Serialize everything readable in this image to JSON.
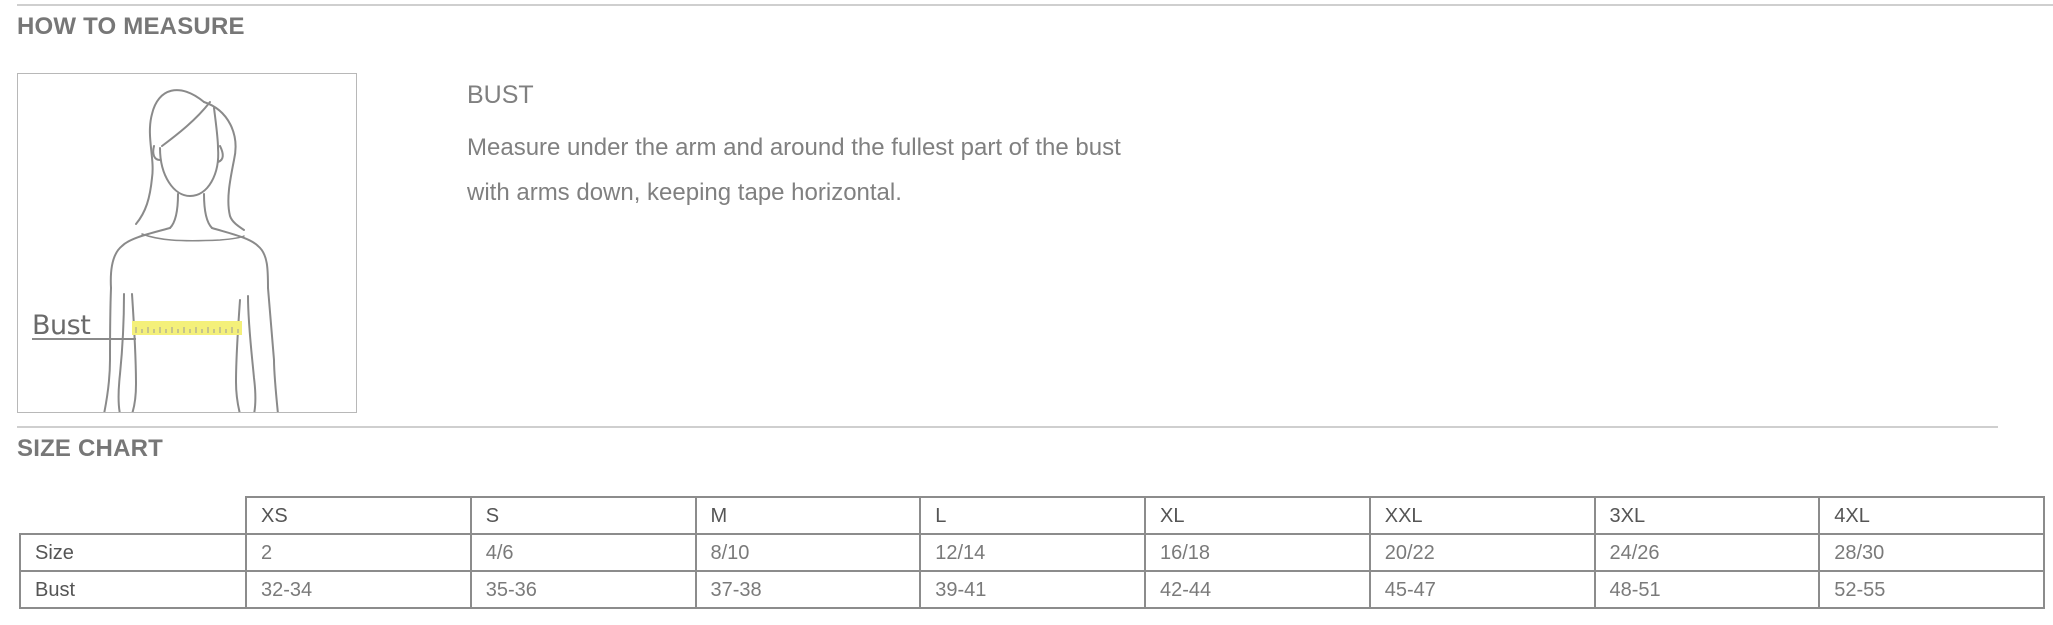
{
  "how_to_measure": {
    "title": "HOW TO MEASURE",
    "figure_label": "Bust",
    "heading": "BUST",
    "description_line1": "Measure under the arm and around the fullest part of the bust",
    "description_line2": "with arms down, keeping tape horizontal."
  },
  "size_chart": {
    "title": "SIZE CHART",
    "columns": [
      "XS",
      "S",
      "M",
      "L",
      "XL",
      "XXL",
      "3XL",
      "4XL"
    ],
    "rows": [
      {
        "label": "Size",
        "values": [
          "2",
          "4/6",
          "8/10",
          "12/14",
          "16/18",
          "20/22",
          "24/26",
          "28/30"
        ]
      },
      {
        "label": "Bust",
        "values": [
          "32-34",
          "35-36",
          "37-38",
          "39-41",
          "42-44",
          "45-47",
          "48-51",
          "52-55"
        ]
      }
    ]
  },
  "colors": {
    "tape": "#f4f07a",
    "outline": "#8a8a8a",
    "border": "#8c8c8c"
  }
}
